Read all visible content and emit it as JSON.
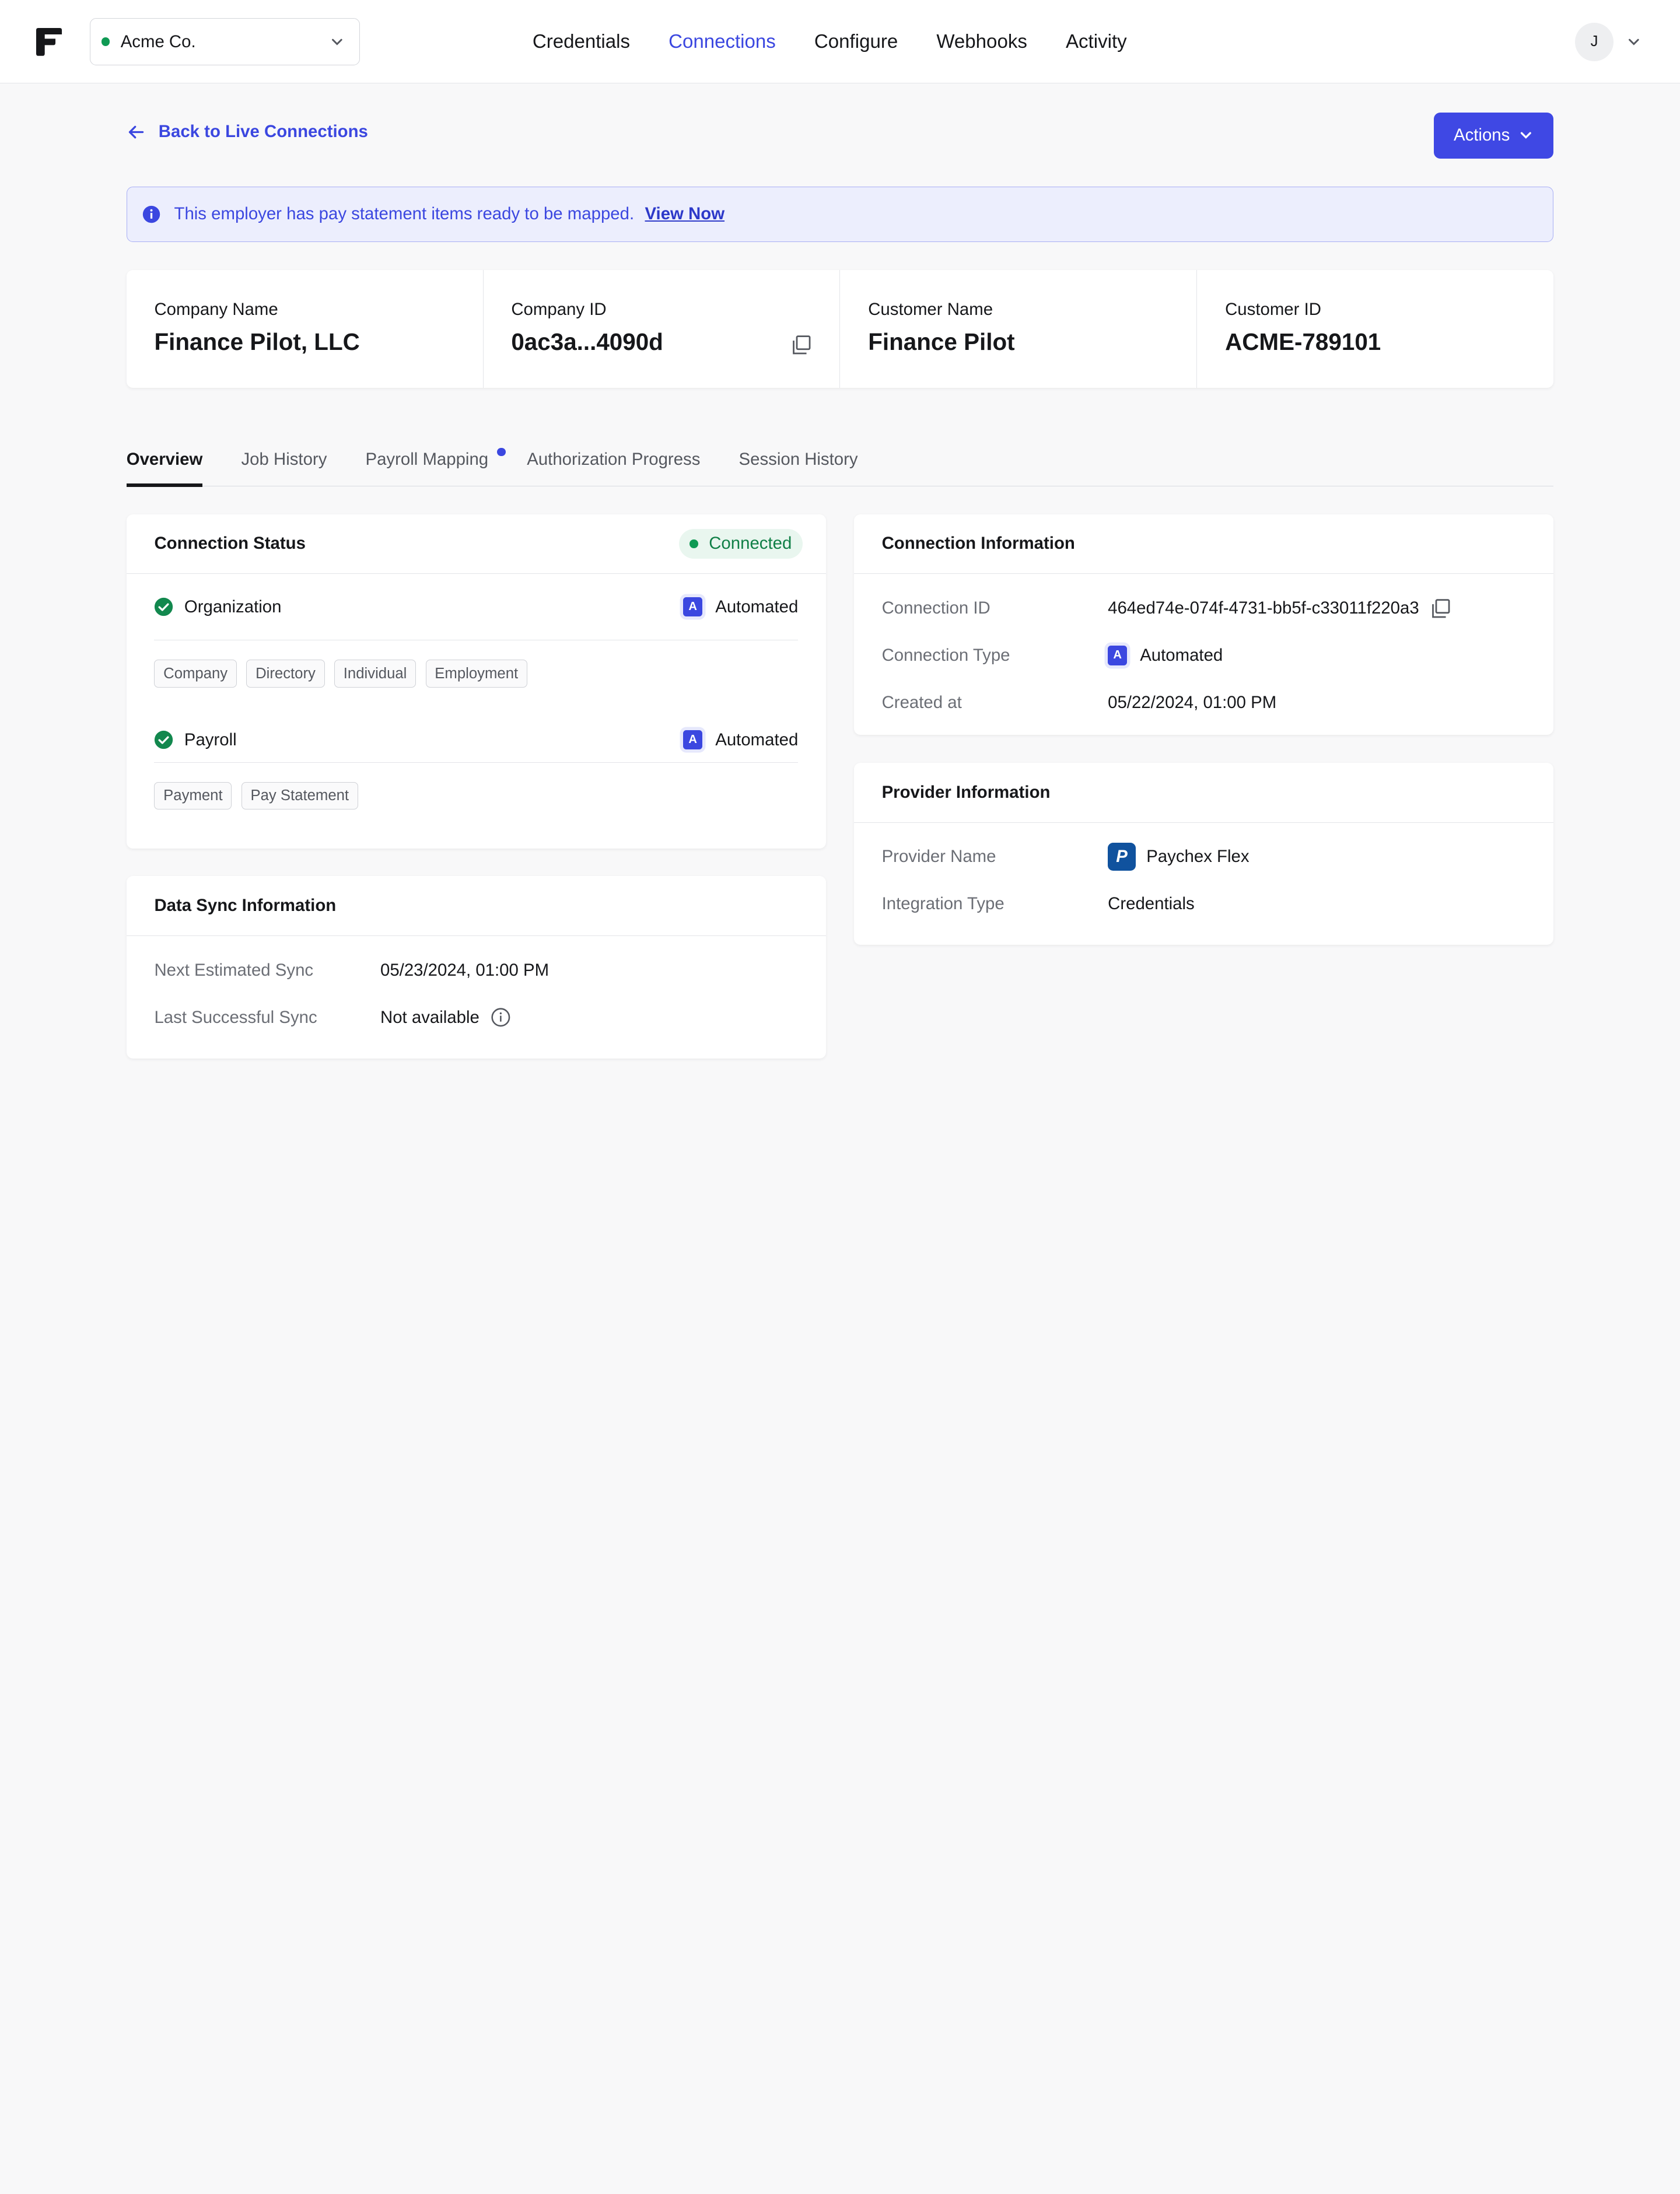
{
  "org_selector": {
    "name": "Acme Co."
  },
  "nav": {
    "items": [
      {
        "label": "Credentials",
        "active": false
      },
      {
        "label": "Connections",
        "active": true
      },
      {
        "label": "Configure",
        "active": false
      },
      {
        "label": "Webhooks",
        "active": false
      },
      {
        "label": "Activity",
        "active": false
      }
    ]
  },
  "user": {
    "initial": "J"
  },
  "back_link": "Back to Live Connections",
  "actions_label": "Actions",
  "banner": {
    "text": "This employer has pay statement items ready to be mapped.",
    "link": "View Now"
  },
  "summary": [
    {
      "label": "Company Name",
      "value": "Finance Pilot, LLC"
    },
    {
      "label": "Company ID",
      "value": "0ac3a...4090d"
    },
    {
      "label": "Customer Name",
      "value": "Finance Pilot"
    },
    {
      "label": "Customer ID",
      "value": "ACME-789101"
    }
  ],
  "tabs": [
    {
      "label": "Overview",
      "active": true
    },
    {
      "label": "Job History"
    },
    {
      "label": "Payroll Mapping",
      "dot": true
    },
    {
      "label": "Authorization Progress"
    },
    {
      "label": "Session History"
    }
  ],
  "connection_status": {
    "title": "Connection Status",
    "status": "Connected",
    "groups": [
      {
        "name": "Organization",
        "mode": "Automated",
        "mode_badge": "A",
        "products": [
          "Company",
          "Directory",
          "Individual",
          "Employment"
        ]
      },
      {
        "name": "Payroll",
        "mode": "Automated",
        "mode_badge": "A",
        "products": [
          "Payment",
          "Pay Statement"
        ]
      }
    ]
  },
  "data_sync": {
    "title": "Data Sync Information",
    "rows": [
      {
        "label": "Next Estimated Sync",
        "value": "05/23/2024, 01:00 PM"
      },
      {
        "label": "Last Successful Sync",
        "value": "Not available"
      }
    ]
  },
  "connection_info": {
    "title": "Connection Information",
    "rows": [
      {
        "label": "Connection ID",
        "value": "464ed74e-074f-4731-bb5f-c33011f220a3"
      },
      {
        "label": "Connection Type",
        "value": "Automated",
        "badge": "A"
      },
      {
        "label": "Created at",
        "value": "05/22/2024, 01:00 PM"
      }
    ]
  },
  "provider_info": {
    "title": "Provider Information",
    "rows": [
      {
        "label": "Provider Name",
        "value": "Paychex Flex",
        "logo_letter": "P"
      },
      {
        "label": "Integration Type",
        "value": "Credentials"
      }
    ]
  },
  "colors": {
    "accent": "#3b47e0",
    "success": "#0f9a54",
    "banner_bg": "#eceefd",
    "provider_brand": "#10529e"
  }
}
